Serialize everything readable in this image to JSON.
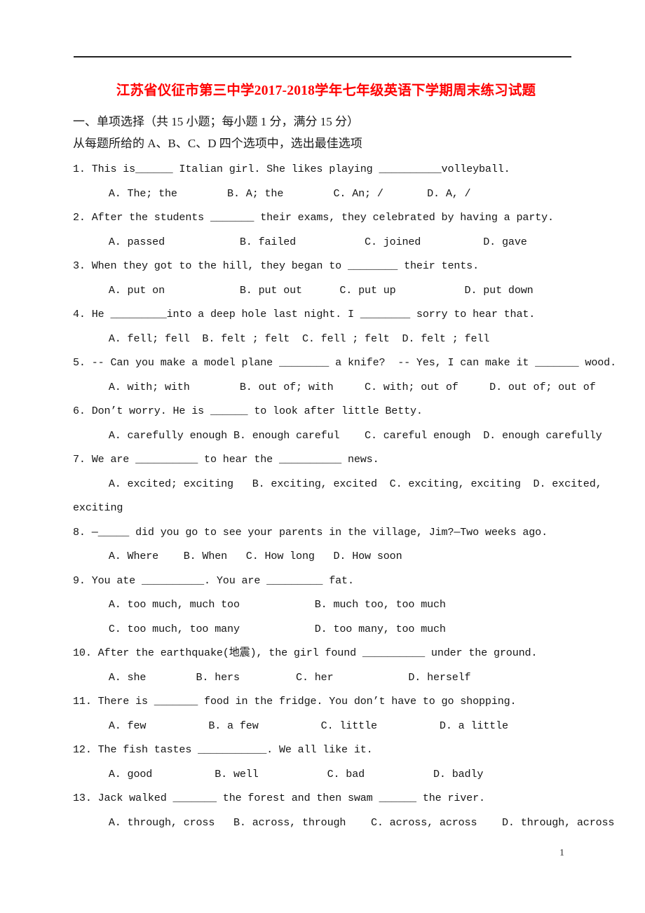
{
  "document": {
    "title": "江苏省仪征市第三中学2017-2018学年七年级英语下学期周末练习试题",
    "title_color": "#ff0000",
    "page_number": "1"
  },
  "section": {
    "heading": "一、单项选择（共 15 小题；每小题 1 分，满分 15 分）",
    "directions": "从每题所给的 A、B、C、D 四个选项中，选出最佳选项"
  },
  "questions": [
    {
      "number": "1.",
      "stem": "1. This is______ Italian girl. She likes playing __________volleyball.",
      "lines": [
        "  A. The; the        B. A; the        C. An; /       D. A, /"
      ]
    },
    {
      "number": "2.",
      "stem": "2. After the students _______ their exams, they celebrated by having a party.",
      "lines": [
        "  A. passed            B. failed           C. joined          D. gave"
      ]
    },
    {
      "number": "3.",
      "stem": "3. When they got to the hill, they began to ________ their tents.",
      "lines": [
        "  A. put on            B. put out      C. put up           D. put down"
      ]
    },
    {
      "number": "4.",
      "stem": "4. He _________into a deep hole last night. I ________ sorry to hear that.",
      "lines": [
        "  A. fell; fell  B. felt ; felt  C. fell ; felt  D. felt ; fell"
      ]
    },
    {
      "number": "5.",
      "stem": "5. -- Can you make a model plane ________ a knife?  -- Yes, I can make it _______ wood.",
      "lines": [
        "  A. with; with        B. out of; with     C. with; out of     D. out of; out of"
      ]
    },
    {
      "number": "6.",
      "stem": "6. Don’t worry. He is ______ to look after little Betty.",
      "lines": [
        "  A. carefully enough B. enough careful    C. careful enough  D. enough carefully"
      ]
    },
    {
      "number": "7.",
      "stem": "7. We are __________ to hear the __________ news.",
      "lines": [
        "  A. excited; exciting   B. exciting, excited  C. exciting, exciting  D. excited,",
        "exciting"
      ]
    },
    {
      "number": "8.",
      "stem": "8. —_____ did you go to see your parents in the village, Jim?—Two weeks ago.",
      "lines": [
        "  A. Where    B. When   C. How long   D. How soon"
      ]
    },
    {
      "number": "9.",
      "stem": "9. You ate __________. You are _________ fat.",
      "lines": [
        "  A. too much, much too            B. much too, too much",
        "  C. too much, too many            D. too many, too much"
      ]
    },
    {
      "number": "10.",
      "stem": "10. After the earthquake(地震), the girl found __________ under the ground.",
      "lines": [
        "  A. she        B. hers         C. her            D. herself"
      ]
    },
    {
      "number": "11.",
      "stem": "11. There is _______ food in the fridge. You don’t have to go shopping.",
      "lines": [
        "  A. few          B. a few          C. little          D. a little"
      ]
    },
    {
      "number": "12.",
      "stem": "12. The fish tastes ___________. We all like it.",
      "lines": [
        "  A. good          B. well           C. bad           D. badly"
      ]
    },
    {
      "number": "13.",
      "stem": "13. Jack walked _______ the forest and then swam ______ the river.",
      "lines": [
        "  A. through, cross   B. across, through    C. across, across    D. through, across"
      ]
    }
  ]
}
